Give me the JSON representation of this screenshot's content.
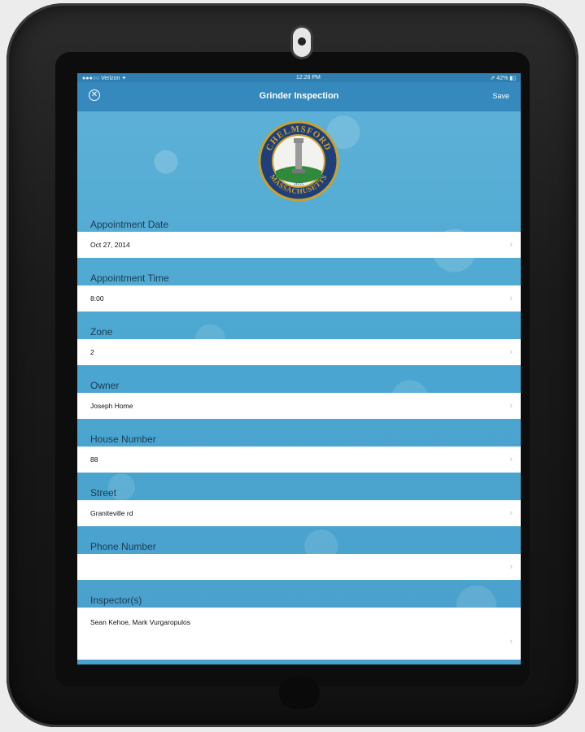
{
  "status_bar": {
    "carrier": "●●●○○ Verizon ✦",
    "time": "12:28 PM",
    "battery": "⇗ 42% ▮▯"
  },
  "nav": {
    "close_icon": "close-circle-icon",
    "title": "Grinder Inspection",
    "save_label": "Save"
  },
  "seal": {
    "top_text": "CHELMSFORD",
    "bottom_text": "MASSACHUSETTS",
    "year": "1655",
    "colors": {
      "ring": "#1f3e7a",
      "gold": "#c9a12b",
      "green": "#2f8b3a"
    }
  },
  "fields": [
    {
      "label": "Appointment Date",
      "value": "Oct 27, 2014"
    },
    {
      "label": "Appointment Time",
      "value": "8:00"
    },
    {
      "label": "Zone",
      "value": "2"
    },
    {
      "label": "Owner",
      "value": "Joseph Home"
    },
    {
      "label": "House Number",
      "value": "88"
    },
    {
      "label": "Street",
      "value": "Graniteville rd"
    },
    {
      "label": "Phone Number",
      "value": ""
    },
    {
      "label": "Inspector(s)",
      "value": "Sean Kehoe, Mark Vurgaropulos"
    }
  ],
  "chevron": "›"
}
